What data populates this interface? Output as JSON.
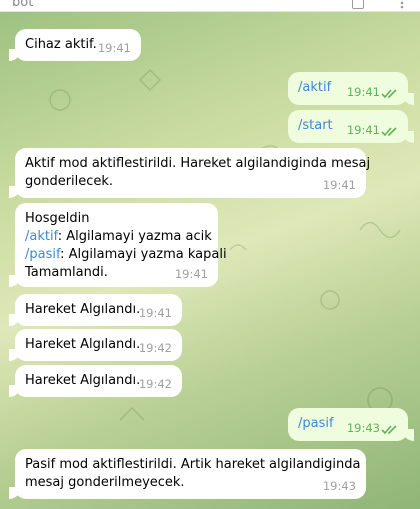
{
  "header": {
    "title": "bot"
  },
  "messages": [
    {
      "text": "Cihaz aktif.",
      "time": "19:41"
    },
    {
      "text": "/aktif",
      "time": "19:41"
    },
    {
      "text": "/start",
      "time": "19:41"
    },
    {
      "lines": [
        "Aktif mod aktiflestirildi. Hareket algilandiginda mesaj",
        "gonderilecek."
      ],
      "time": "19:41"
    },
    {
      "line1": "Hosgeldin",
      "cmd1": "/aktif",
      "rest1": ": Algilamayi yazma acik",
      "cmd2": "/pasif",
      "rest2": ": Algilamayi yazma kapali",
      "line4": "Tamamlandi.",
      "time": "19:41"
    },
    {
      "text": "Hareket Algılandı.",
      "time": "19:41"
    },
    {
      "text": "Hareket Algılandı.",
      "time": "19:42"
    },
    {
      "text": "Hareket Algılandı.",
      "time": "19:42"
    },
    {
      "text": "/pasif",
      "time": "19:43"
    },
    {
      "lines": [
        "Pasif mod aktiflestirildi. Artik hareket algilandiginda",
        "mesaj gonderilmeyecek."
      ],
      "time": "19:43"
    }
  ],
  "colors": {
    "incoming": "#ffffff",
    "outgoing": "#effdde",
    "command": "#3a8ad6",
    "check": "#5fb356"
  },
  "icons": {
    "read_receipt": "double-check-icon"
  }
}
